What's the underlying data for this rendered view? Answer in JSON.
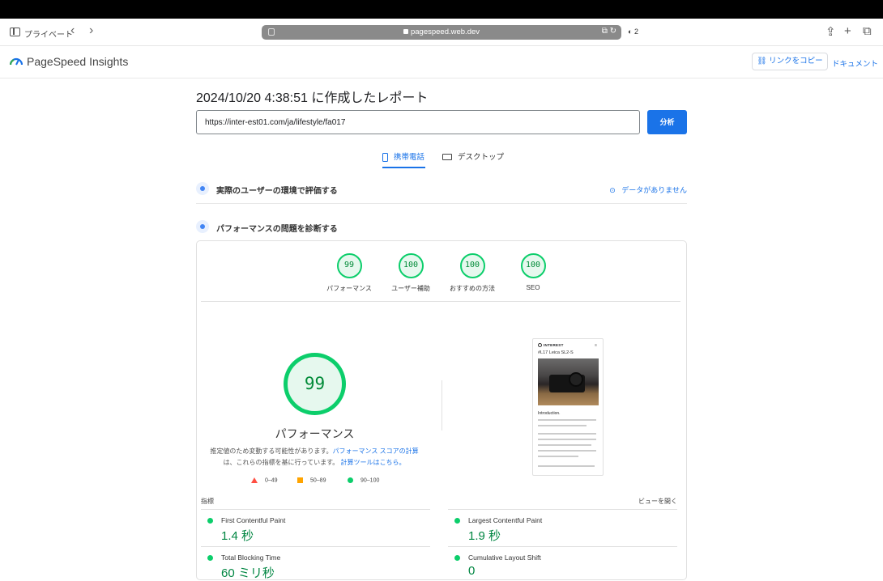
{
  "browser": {
    "private_label": "プライベート",
    "back_icon": "chevron-left",
    "forward_icon": "chevron-right",
    "address": "pagespeed.web.dev",
    "translate_indicator": "⧉ ↻",
    "tab_count": "2"
  },
  "header": {
    "brand": "PageSpeed Insights",
    "copy_link": "リンクをコピー",
    "docs": "ドキュメント"
  },
  "report": {
    "title": "2024/10/20 4:38:51 に作成したレポート",
    "url_value": "https://inter-est01.com/ja/lifestyle/fa017",
    "analyze_button": "分析"
  },
  "tabs": [
    {
      "label": "携帯電話",
      "active": true
    },
    {
      "label": "デスクトップ",
      "active": false
    }
  ],
  "field_data": {
    "title": "実際のユーザーの環境で評価する",
    "status": "データがありません"
  },
  "diagnose": {
    "title": "パフォーマンスの問題を診断する"
  },
  "scores": [
    {
      "value": "99",
      "label": "パフォーマンス"
    },
    {
      "value": "100",
      "label": "ユーザー補助"
    },
    {
      "value": "100",
      "label": "おすすめの方法"
    },
    {
      "value": "100",
      "label": "SEO"
    }
  ],
  "performance": {
    "score": "99",
    "title": "パフォーマンス",
    "note_part1": "推定値のため変動する可能性があります。",
    "note_link1": "パフォーマンス スコアの計算",
    "note_part2": "は、これらの指標を基に行っています。",
    "note_link2": "計算ツールはこちら。",
    "legend": {
      "low": "0–49",
      "mid": "50–89",
      "high": "90–100"
    }
  },
  "thumbnail": {
    "brand": "INTEREST",
    "title": "#L17 Leica SL2-S",
    "intro": "Introduction."
  },
  "metrics": {
    "label": "指標",
    "view_toggle": "ビューを開く",
    "items": [
      {
        "name": "First Contentful Paint",
        "value": "1.4 秒"
      },
      {
        "name": "Largest Contentful Paint",
        "value": "1.9 秒"
      },
      {
        "name": "Total Blocking Time",
        "value": "60 ミリ秒"
      },
      {
        "name": "Cumulative Layout Shift",
        "value": "0"
      }
    ]
  },
  "colors": {
    "accent": "#1a73e8",
    "pass": "#0cce6b",
    "pass_text": "#008a37",
    "average": "#ffa400",
    "fail": "#ff4e42"
  }
}
